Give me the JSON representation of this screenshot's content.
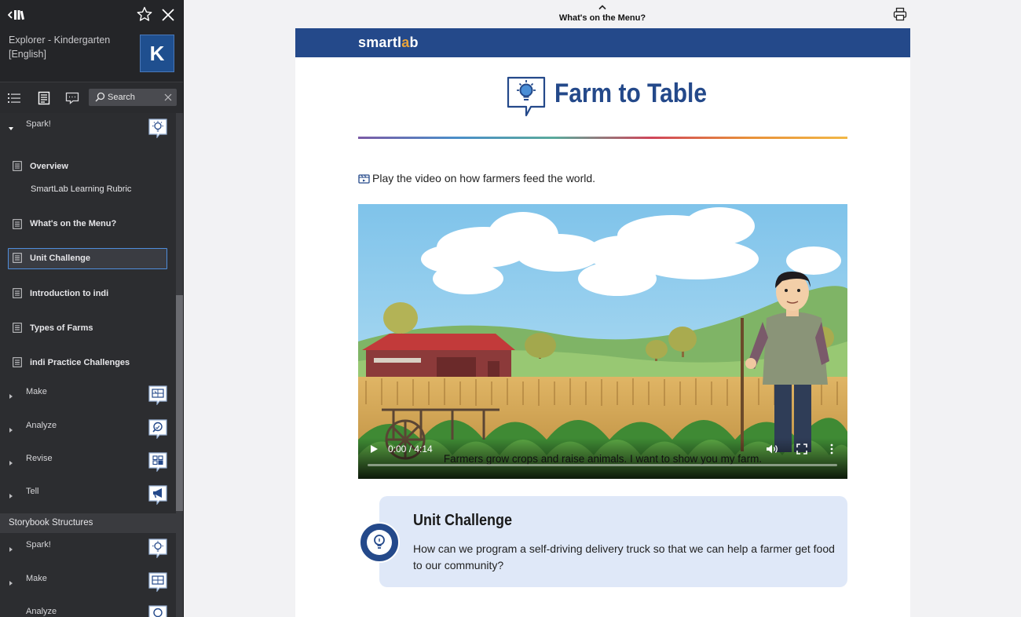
{
  "sidebar": {
    "book_title": "Explorer - Kindergarten [English]",
    "cover_letter": "K",
    "search_placeholder": "Search",
    "items": [
      {
        "type": "section",
        "label": "Spark!",
        "expanded": true,
        "icon": "lightbulb-icon"
      },
      {
        "type": "page",
        "label": "Overview"
      },
      {
        "type": "sub",
        "label": "SmartLab Learning Rubric"
      },
      {
        "type": "page",
        "label": "What's on the Menu?"
      },
      {
        "type": "page",
        "label": "Unit Challenge",
        "active": true
      },
      {
        "type": "page",
        "label": "Introduction to indi"
      },
      {
        "type": "page",
        "label": "Types of Farms"
      },
      {
        "type": "page",
        "label": "indi Practice Challenges"
      },
      {
        "type": "section",
        "label": "Make",
        "icon": "blueprint-icon"
      },
      {
        "type": "section",
        "label": "Analyze",
        "icon": "magnifier-icon"
      },
      {
        "type": "section",
        "label": "Revise",
        "icon": "grid-icon"
      },
      {
        "type": "section",
        "label": "Tell",
        "icon": "megaphone-icon"
      }
    ],
    "group": {
      "label": "Storybook Structures",
      "items": [
        {
          "type": "section",
          "label": "Spark!",
          "icon": "lightbulb-icon"
        },
        {
          "type": "section",
          "label": "Make",
          "icon": "blueprint-icon"
        },
        {
          "type": "section",
          "label": "Analyze",
          "icon": "magnifier-icon"
        }
      ]
    }
  },
  "topbar": {
    "title": "What's on the Menu?"
  },
  "page": {
    "brand": {
      "pre": "smartl",
      "accent": "a",
      "post": "b"
    },
    "title": "Farm to Table",
    "video_hint": "Play the video on how farmers feed the world.",
    "video": {
      "time": "0:00 / 4:14",
      "caption": "Farmers grow crops and raise animals. I want to show you my farm.",
      "progress": 0
    },
    "challenge": {
      "title": "Unit Challenge",
      "text": "How can we program a self-driving delivery truck so that we can help a farmer get food to our community?"
    }
  },
  "colors": {
    "sidebar_bg": "#2c2d30",
    "brand_blue": "#24498a",
    "active_border": "#4f8edc",
    "challenge_bg": "#dfe8f8"
  }
}
